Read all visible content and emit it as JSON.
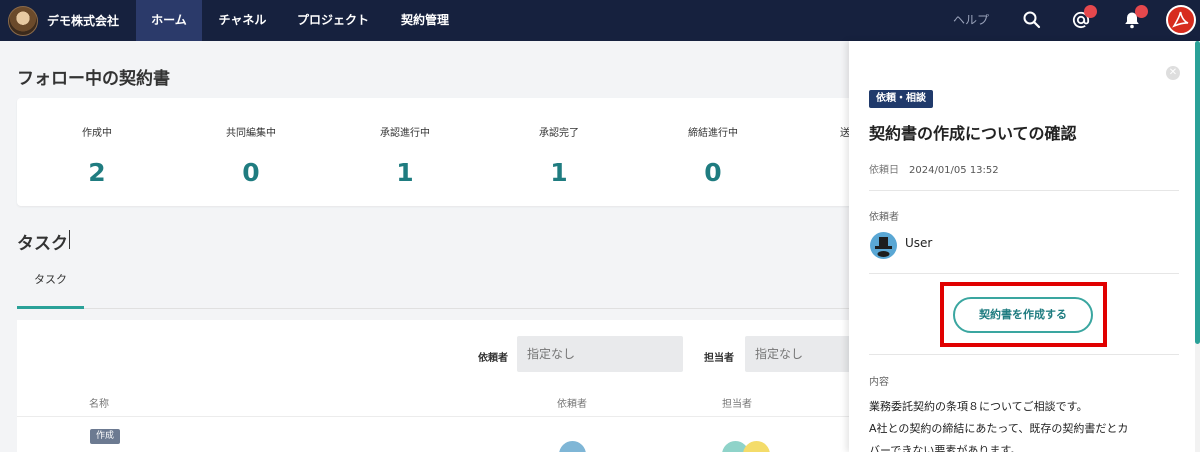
{
  "nav": {
    "company": "デモ株式会社",
    "items": [
      "ホーム",
      "チャネル",
      "プロジェクト",
      "契約管理"
    ],
    "help": "ヘルプ",
    "accent": "#16213e"
  },
  "following": {
    "title": "フォロー中の契約書",
    "stats": [
      {
        "label": "作成中",
        "value": "2"
      },
      {
        "label": "共同編集中",
        "value": "0"
      },
      {
        "label": "承認進行中",
        "value": "1"
      },
      {
        "label": "承認完了",
        "value": "1"
      },
      {
        "label": "締結進行中",
        "value": "0"
      },
      {
        "label": "送",
        "value": ""
      }
    ]
  },
  "tasks": {
    "title": "タスク",
    "tab": "タスク",
    "filters": {
      "requester_label": "依頼者",
      "requester_placeholder": "指定なし",
      "assignee_label": "担当者",
      "assignee_placeholder": "指定なし"
    },
    "columns": {
      "name": "名称",
      "requester": "依頼者",
      "assignee": "担当者"
    },
    "rows": [
      {
        "tag": "作成"
      }
    ]
  },
  "panel": {
    "tag": "依頼・相談",
    "title": "契約書の作成についての確認",
    "date_label": "依頼日",
    "date_value": "2024/01/05 13:52",
    "requester_label": "依頼者",
    "requester_name": "User",
    "create_button": "契約書を作成する",
    "content_label": "内容",
    "content_lines": [
      "業務委託契約の条項８についてご相談です。",
      "A社との契約の締結にあたって、既存の契約書だとカ",
      "バーできない要素があります。"
    ]
  }
}
